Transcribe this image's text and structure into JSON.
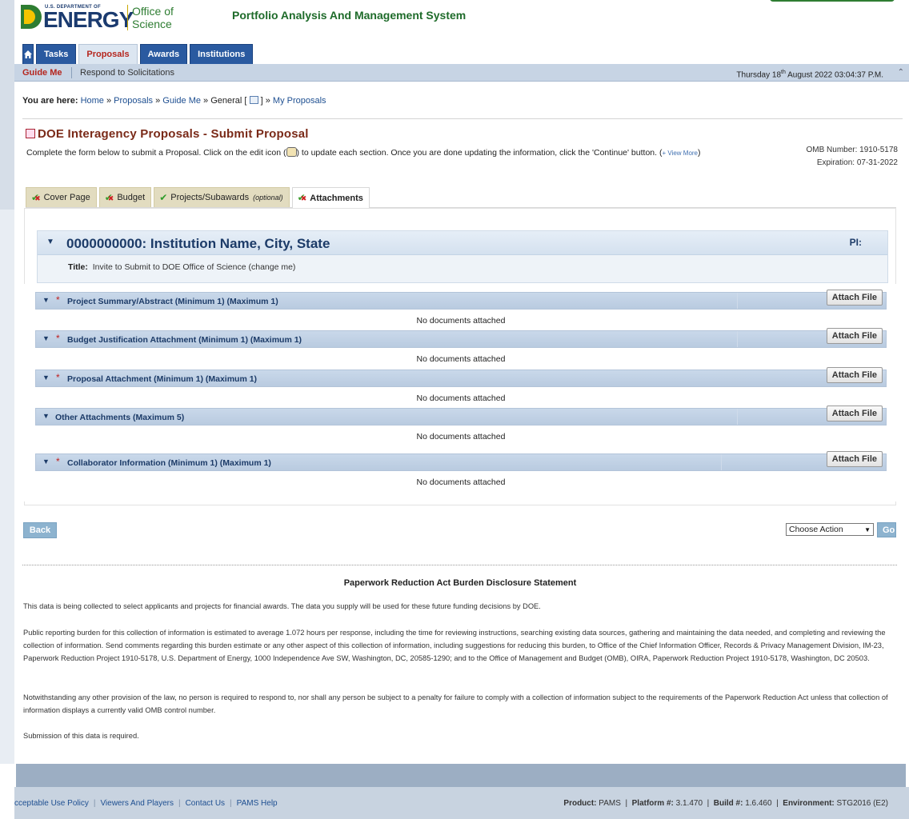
{
  "header": {
    "logo_dept": "U.S. DEPARTMENT OF",
    "logo_word": "ENERGY",
    "logo_office_line1": "Office of",
    "logo_office_line2": "Science",
    "app_title": "Portfolio Analysis And Management System"
  },
  "main_tabs": [
    {
      "label": "Tasks"
    },
    {
      "label": "Proposals",
      "active": true
    },
    {
      "label": "Awards"
    },
    {
      "label": "Institutions"
    }
  ],
  "subnav": {
    "guide_me": "Guide Me",
    "respond": "Respond to Solicitations",
    "date_prefix": "Thursday 18",
    "date_sup": "th",
    "date_suffix": " August 2022 03:04:37 P.M."
  },
  "breadcrumb": {
    "label": "You are here:",
    "home": "Home",
    "proposals": "Proposals",
    "guide_me": "Guide Me",
    "general": "General [",
    "general_close": "]",
    "my_proposals": "My Proposals",
    "sep": " » "
  },
  "page": {
    "title": "DOE Interagency Proposals - Submit Proposal",
    "instr_before": "Complete the form below to submit a Proposal. Click on the edit icon (",
    "instr_after": ") to update each section. Once you are done updating the information, click the 'Continue' button. (",
    "view_more": "+ View More",
    "instr_close": ")",
    "omb_number": "OMB Number: 1910-5178",
    "expiration": "Expiration: 07-31-2022"
  },
  "section_tabs": [
    {
      "label": "Cover Page",
      "status": "mixed"
    },
    {
      "label": "Budget",
      "status": "mixed"
    },
    {
      "label": "Projects/Subawards",
      "optional": "(optional)",
      "status": "ok"
    },
    {
      "label": "Attachments",
      "status": "mixed",
      "active": true
    }
  ],
  "institution": {
    "name": "0000000000: Institution Name, City, State",
    "pi_label": "PI:",
    "title_label": "Title:",
    "title_value": "Invite to Submit to DOE Office of Science (change me)"
  },
  "attachments": {
    "button_label": "Attach File",
    "empty_text": "No documents attached",
    "sections": [
      {
        "label": "Project Summary/Abstract (Minimum 1) (Maximum 1)",
        "required": true
      },
      {
        "label": "Budget Justification Attachment (Minimum 1) (Maximum 1)",
        "required": true
      },
      {
        "label": "Proposal Attachment (Minimum 1) (Maximum 1)",
        "required": true
      },
      {
        "label": "Other Attachments (Maximum 5)",
        "required": false
      },
      {
        "label": "Collaborator Information (Minimum 1) (Maximum 1)",
        "required": true
      }
    ]
  },
  "actions": {
    "back": "Back",
    "choose_action": "Choose Action",
    "go": "Go"
  },
  "pra": {
    "title": "Paperwork Reduction Act Burden Disclosure Statement",
    "p1": "This data is being collected to select applicants and projects for financial awards. The data you supply will be used for these future funding decisions by DOE.",
    "p2": "Public reporting burden for this collection of information is estimated to average 1.072 hours per response, including the time for reviewing instructions, searching existing data sources, gathering and maintaining the data needed, and completing and reviewing the collection of information. Send comments regarding this burden estimate or any other aspect of this collection of information, including suggestions for reducing this burden, to Office of the Chief Information Officer, Records & Privacy Management Division, IM-23, Paperwork Reduction Project 1910-5178, U.S. Department of Energy, 1000 Independence Ave SW, Washington, DC, 20585-1290; and to the Office of Management and Budget (OMB), OIRA, Paperwork Reduction Project 1910-5178, Washington, DC 20503.",
    "p3": "Notwithstanding any other provision of the law, no person is required to respond to, nor shall any person be subject to a penalty for failure to comply with a collection of information subject to the requirements of the Paperwork Reduction Act unless that collection of information displays a currently valid OMB control number.",
    "p4": "Submission of this data is required."
  },
  "footer": {
    "links": [
      "cceptable Use Policy",
      "Viewers And Players",
      "Contact Us",
      "PAMS Help"
    ],
    "product_label": "Product:",
    "product_value": "PAMS",
    "platform_label": "Platform #:",
    "platform_value": "3.1.470",
    "build_label": "Build #:",
    "build_value": "1.6.460",
    "env_label": "Environment:",
    "env_value": "STG2016 (E2)"
  },
  "colors": {
    "tab_blue": "#2a5aa0",
    "active_tab_red": "#b5261e",
    "title_brown": "#7a2a18",
    "app_green": "#1e6b2a"
  }
}
